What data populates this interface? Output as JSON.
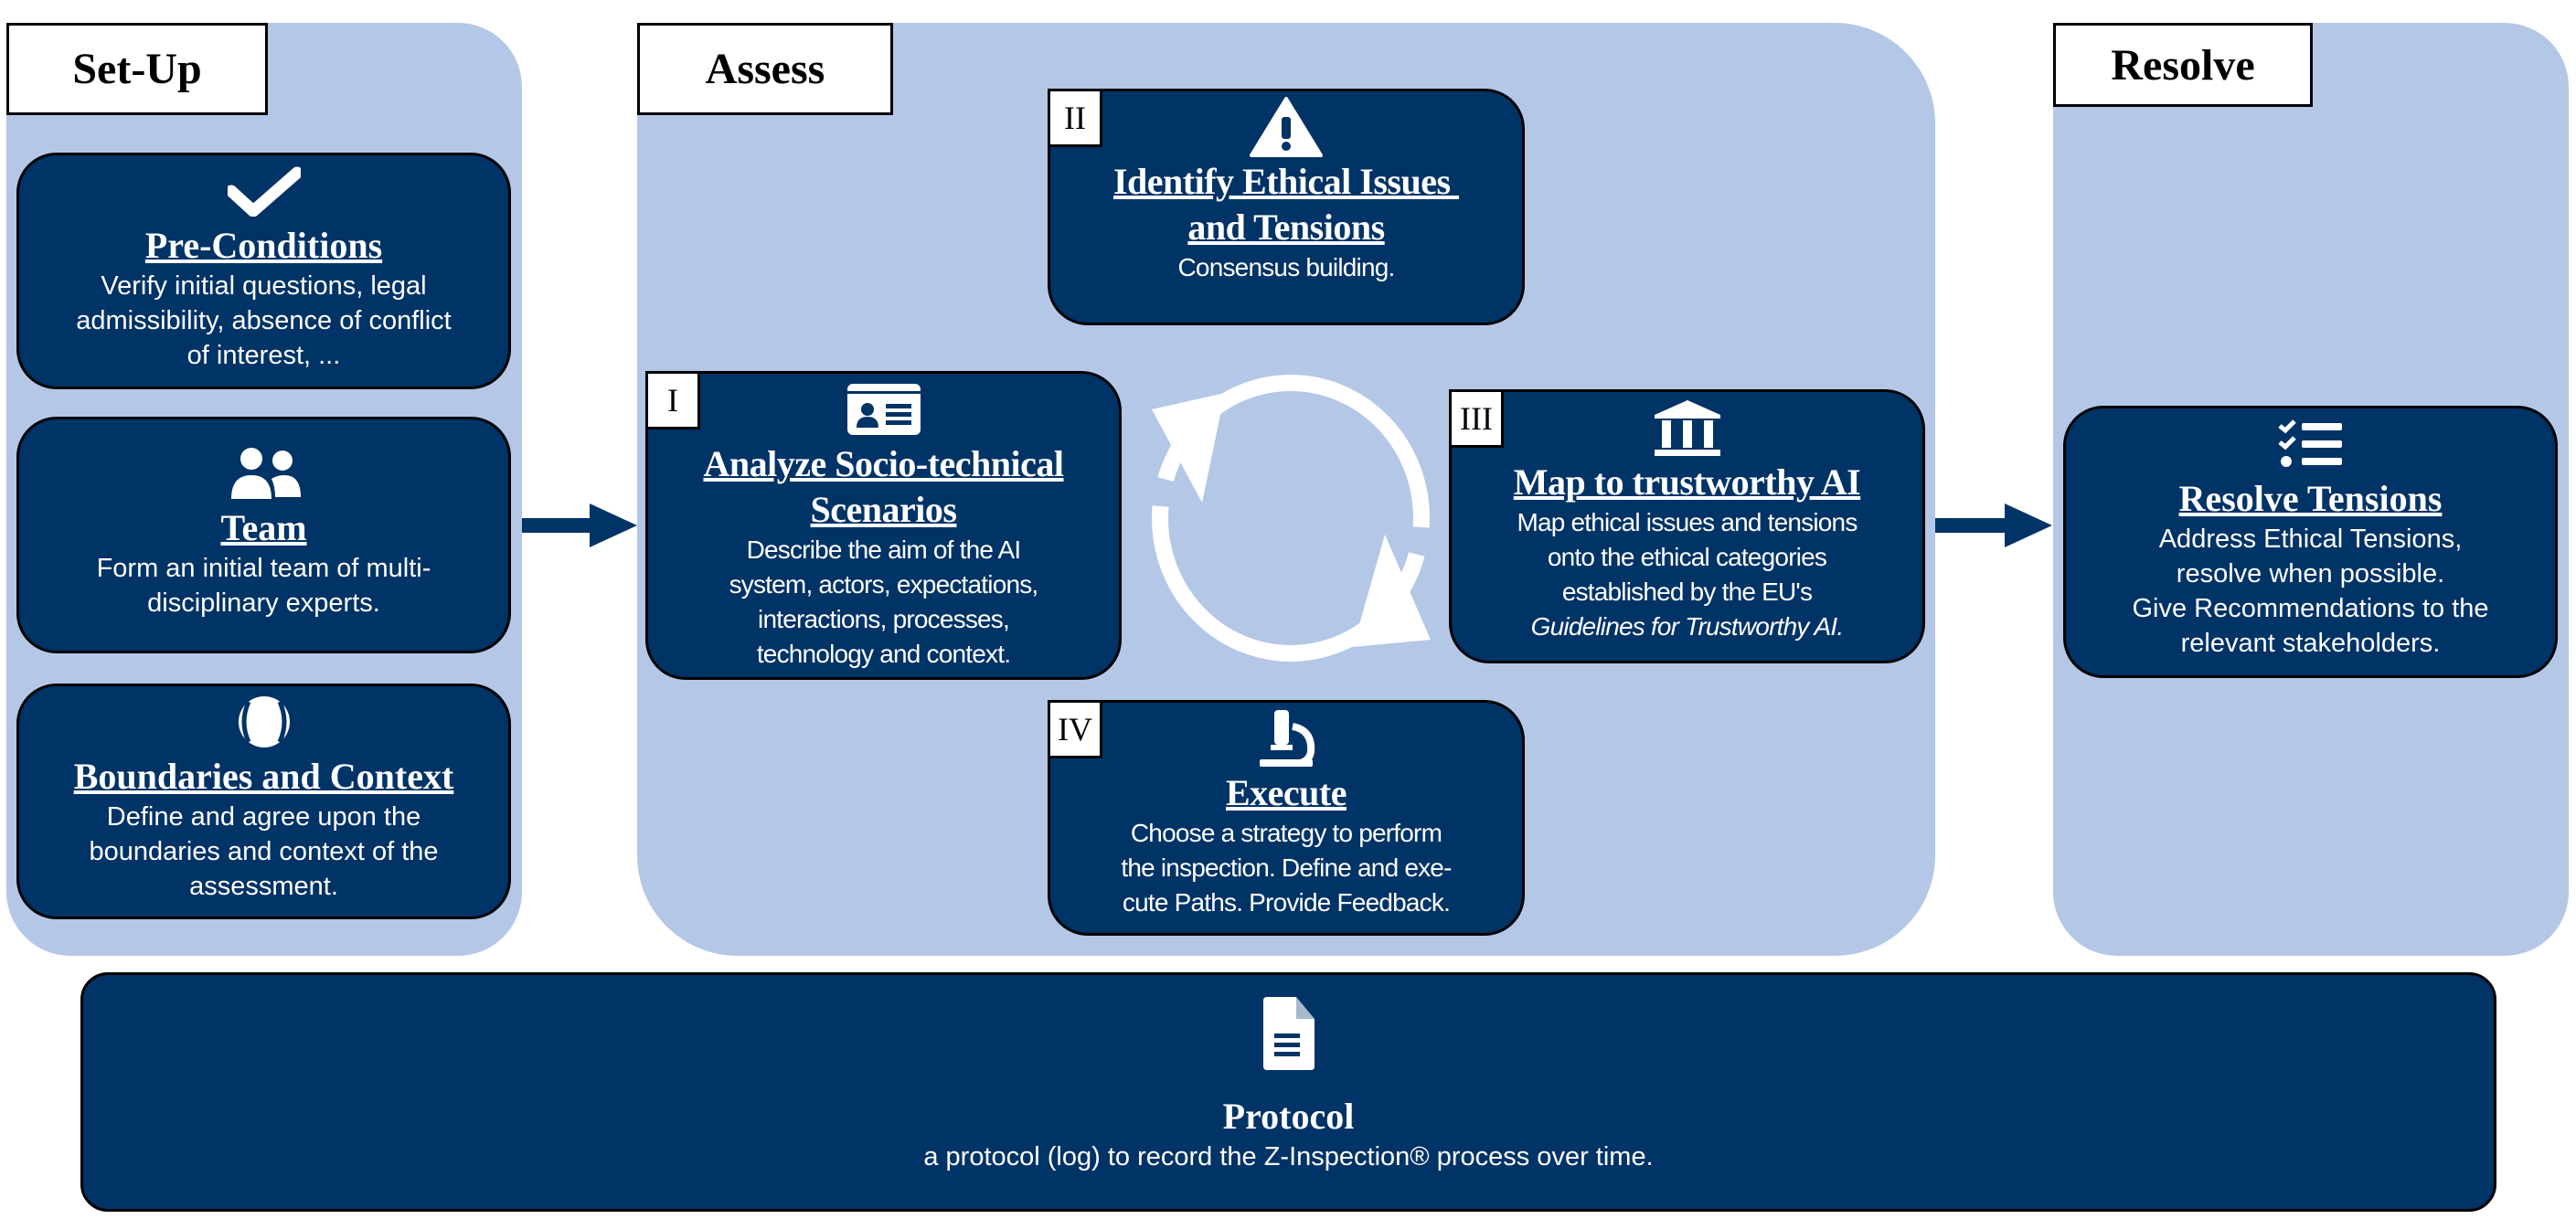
{
  "colors": {
    "panel": "#B4C7E7",
    "card": "#003366",
    "text": "#FFFFFF"
  },
  "setup": {
    "label": "Set-Up",
    "cards": [
      {
        "icon": "checkmark-icon",
        "title": "Pre-Conditions",
        "lines": [
          "Verify initial questions, legal",
          "admissibility, absence of conflict",
          "of interest, ..."
        ]
      },
      {
        "icon": "users-icon",
        "title": "Team",
        "lines": [
          "Form an initial team of multi-",
          "disciplinary experts."
        ]
      },
      {
        "icon": "baseball-icon",
        "title": "Boundaries and Context",
        "lines": [
          "Define and agree upon the",
          "boundaries and context of the",
          "assessment."
        ]
      }
    ]
  },
  "assess": {
    "label": "Assess",
    "cards": [
      {
        "num": "I",
        "icon": "id-card-icon",
        "title_lines": [
          "Analyze Socio-technical",
          "Scenarios"
        ],
        "lines": [
          "Describe the aim of the AI",
          "system, actors, expectations,",
          "interactions, processes,",
          "technology and context."
        ]
      },
      {
        "num": "II",
        "icon": "warning-icon",
        "title_lines": [
          "Identify Ethical Issues ",
          "and Tensions"
        ],
        "lines": [
          "Consensus building."
        ]
      },
      {
        "num": "III",
        "icon": "institution-icon",
        "title_lines": [
          "Map to trustworthy AI"
        ],
        "lines": [
          "Map ethical issues and tensions",
          "onto the ethical categories",
          "established by the EU's"
        ],
        "italic_line": "Guidelines for Trustworthy AI."
      },
      {
        "num": "IV",
        "icon": "microscope-icon",
        "title_lines": [
          "Execute"
        ],
        "lines": [
          "Choose a strategy to perform",
          "the inspection. Define and exe-",
          "cute Paths. Provide Feedback."
        ]
      }
    ]
  },
  "resolve": {
    "label": "Resolve",
    "card": {
      "icon": "checklist-icon",
      "title": "Resolve Tensions",
      "lines": [
        "Address Ethical Tensions,",
        "resolve when possible.",
        "Give Recommendations to the",
        "relevant stakeholders."
      ]
    }
  },
  "protocol": {
    "icon": "document-icon",
    "title": "Protocol",
    "text": "a protocol (log) to record the Z-Inspection® process over time."
  }
}
